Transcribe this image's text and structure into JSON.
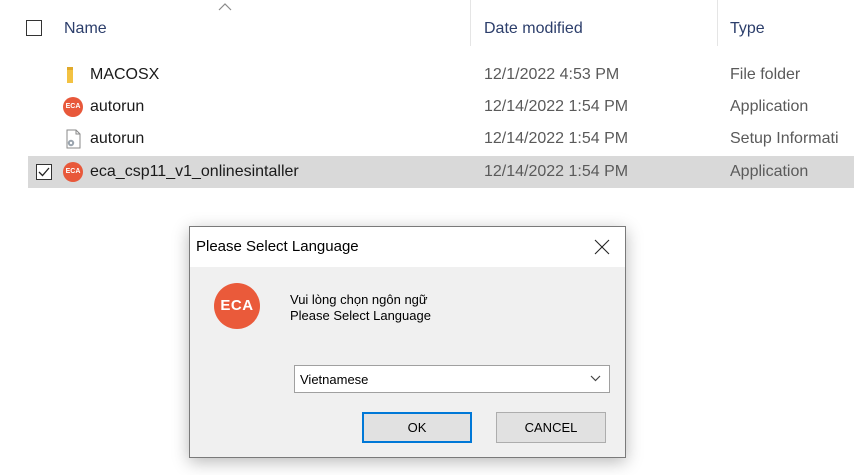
{
  "explorer": {
    "columns": {
      "name": "Name",
      "date": "Date modified",
      "type": "Type"
    },
    "files": [
      {
        "name": "MACOSX",
        "date": "12/1/2022 4:53 PM",
        "type": "File folder",
        "icon": "folder-icon",
        "selected": false
      },
      {
        "name": "autorun",
        "date": "12/14/2022 1:54 PM",
        "type": "Application",
        "icon": "eca-app-icon",
        "selected": false
      },
      {
        "name": "autorun",
        "date": "12/14/2022 1:54 PM",
        "type": "Setup Informati",
        "icon": "setup-info-icon",
        "selected": false
      },
      {
        "name": "eca_csp11_v1_onlinesintaller",
        "date": "12/14/2022 1:54 PM",
        "type": "Application",
        "icon": "eca-app-icon",
        "selected": true
      }
    ],
    "icon_badge_text": "ECA"
  },
  "dialog": {
    "title": "Please Select Language",
    "logo_text": "ECA",
    "message_line1": "Vui lòng chọn ngôn ngữ",
    "message_line2": "Please Select Language",
    "selected_language": "Vietnamese",
    "ok_label": "OK",
    "cancel_label": "CANCEL"
  },
  "colors": {
    "eca_orange": "#ea5a3a",
    "selection": "#d9d9d9",
    "focus_blue": "#0078d7"
  }
}
